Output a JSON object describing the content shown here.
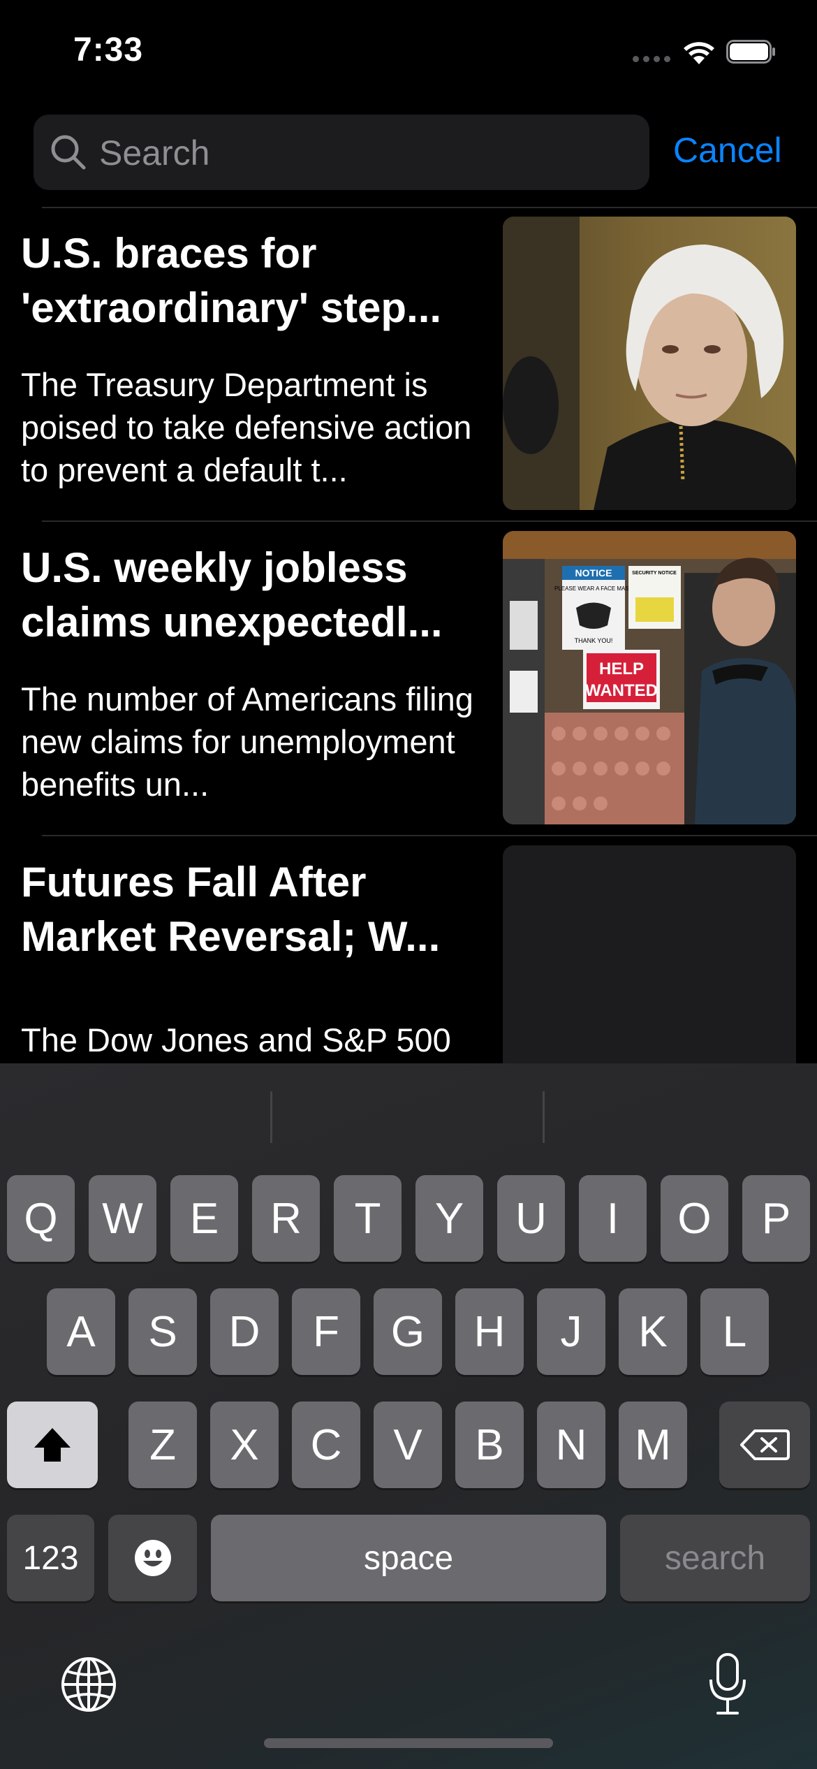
{
  "status_bar": {
    "time": "7:33"
  },
  "search": {
    "placeholder": "Search",
    "value": "",
    "cancel_label": "Cancel"
  },
  "articles": [
    {
      "headline": "U.S. braces for 'extraordinary' step...",
      "summary": "The Treasury Department is poised to take defensive action to prevent a default t..."
    },
    {
      "headline": "U.S. weekly jobless claims unexpectedl...",
      "summary": "The number of Americans filing new claims for unemployment benefits un...",
      "image_text": {
        "notice": "NOTICE",
        "mask": "PLEASE WEAR A FACE MASK",
        "thanks": "THANK YOU!",
        "security": "SECURITY NOTICE",
        "help": "HELP",
        "wanted": "WANTED"
      }
    },
    {
      "headline": "Futures Fall After Market Reversal; W...",
      "summary": "The Dow Jones and S&P 500"
    }
  ],
  "keyboard": {
    "row1": [
      "Q",
      "W",
      "E",
      "R",
      "T",
      "Y",
      "U",
      "I",
      "O",
      "P"
    ],
    "row2": [
      "A",
      "S",
      "D",
      "F",
      "G",
      "H",
      "J",
      "K",
      "L"
    ],
    "row3": [
      "Z",
      "X",
      "C",
      "V",
      "B",
      "N",
      "M"
    ],
    "numbers_label": "123",
    "space_label": "space",
    "search_label": "search"
  }
}
